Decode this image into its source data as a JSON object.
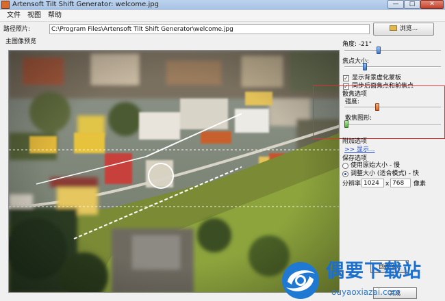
{
  "window": {
    "title": "Artensoft Tilt Shift Generator: welcome.jpg",
    "min_label": "—",
    "max_label": "□",
    "close_label": "✕"
  },
  "menu": [
    {
      "label": "文件"
    },
    {
      "label": "视图"
    },
    {
      "label": "帮助"
    }
  ],
  "path": {
    "label": "路径照片:",
    "value": "C:\\Program Files\\Artensoft Tilt Shift Generator\\welcome.jpg",
    "browse_label": "浏览..."
  },
  "preview": {
    "label": "主图像预览"
  },
  "controls": {
    "angle_label": "角度: -21°",
    "angle_value": 0.4,
    "focus_size_label": "焦点大小:",
    "focus_size_value": 0.25,
    "show_blur_mask_label": "显示背景虚化蒙板",
    "show_blur_mask_checked": true,
    "sync_focus_label": "同步后面焦点和前焦点",
    "sync_focus_checked": true,
    "blur_options_label": "散焦选项",
    "strength_label": "强度:",
    "strength_value": 0.35,
    "blur_shape_label": "散焦图形:",
    "blur_shape_value": 0.0,
    "extra_options_label": "附加选项",
    "show_link_label": ">> 显示..."
  },
  "save": {
    "label": "保存选项",
    "original_size_label": "使用原始大小 - 慢",
    "original_size_selected": false,
    "adjust_size_label": "调整大小 (适合模式) - 快",
    "adjust_size_selected": true,
    "resolution_label": "分辨率",
    "width": "1024",
    "x_label": "x",
    "height": "768",
    "pixels_label": "像素"
  },
  "buttons": {
    "create_label": "创建预览",
    "done_label": "完成"
  },
  "watermark": {
    "title": "偶要下载站",
    "url": "ouyaoxiazai.com"
  },
  "colors": {
    "link": "#1f44c9",
    "highlight_box": "#dd3333",
    "watermark_blue": "#1a6fcf"
  }
}
